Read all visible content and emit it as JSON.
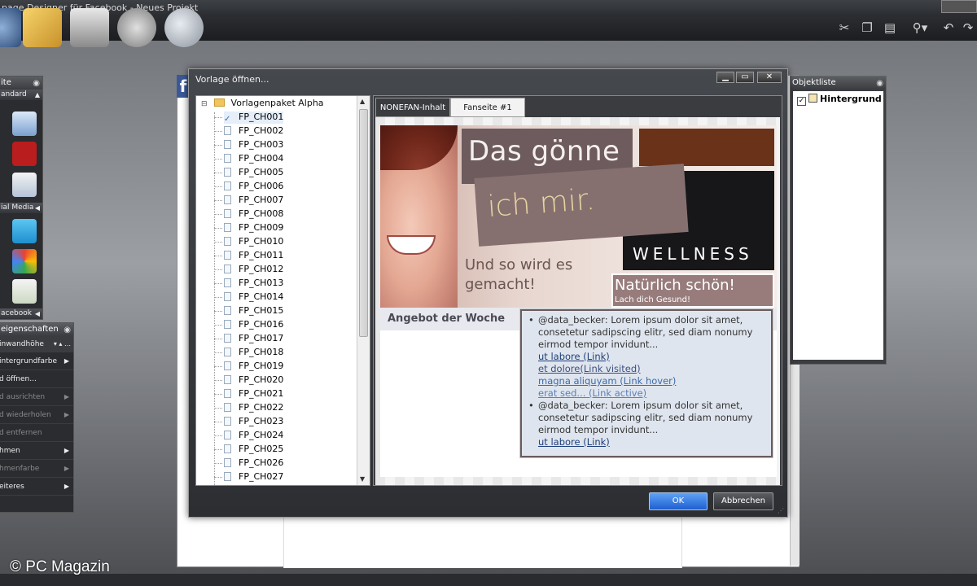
{
  "app": {
    "title": "page Designer für Facebook - Neues Projekt"
  },
  "left_panel": {
    "title": "ite",
    "sections": [
      "andard",
      "ial Media",
      "acebook"
    ]
  },
  "properties_panel": {
    "title": "eigenschaften",
    "field_label": "inwandhöhe",
    "items": [
      {
        "label": "intergrundfarbe",
        "enabled": true,
        "submenu": true
      },
      {
        "label": "d öffnen...",
        "enabled": true,
        "submenu": false
      },
      {
        "label": "d ausrichten",
        "enabled": false,
        "submenu": true
      },
      {
        "label": "d wiederholen",
        "enabled": false,
        "submenu": true
      },
      {
        "label": "d entfernen",
        "enabled": false,
        "submenu": false
      },
      {
        "label": "hmen",
        "enabled": true,
        "submenu": true
      },
      {
        "label": "hmenfarbe",
        "enabled": false,
        "submenu": true
      },
      {
        "label": "eiteres",
        "enabled": true,
        "submenu": true
      }
    ]
  },
  "object_list": {
    "title": "Objektliste",
    "items": [
      {
        "label": "Hintergrund",
        "checked": true
      }
    ]
  },
  "dialog": {
    "title": "Vorlage öffnen...",
    "tree": {
      "root": "Vorlagenpaket Alpha",
      "items": [
        "FP_CH001",
        "FP_CH002",
        "FP_CH003",
        "FP_CH004",
        "FP_CH005",
        "FP_CH006",
        "FP_CH007",
        "FP_CH008",
        "FP_CH009",
        "FP_CH010",
        "FP_CH011",
        "FP_CH012",
        "FP_CH013",
        "FP_CH014",
        "FP_CH015",
        "FP_CH016",
        "FP_CH017",
        "FP_CH018",
        "FP_CH019",
        "FP_CH020",
        "FP_CH021",
        "FP_CH022",
        "FP_CH023",
        "FP_CH024",
        "FP_CH025",
        "FP_CH026",
        "FP_CH027"
      ],
      "selected_index": 0
    },
    "tabs": [
      {
        "label": "NONEFAN-Inhalt",
        "active": false
      },
      {
        "label": "Fanseite #1",
        "active": true
      }
    ],
    "preview": {
      "headline_1": "Das gönne",
      "headline_2": "ich mir.",
      "wellness": "WELLNESS",
      "subline": "Und so wird es gemacht!",
      "natuerlich": "Natürlich schön!",
      "lach": "Lach dich Gesund!",
      "offer_title": "Angebot der Woche",
      "offer_items": [
        {
          "text": "@data_becker: Lorem ipsum dolor sit amet, consetetur sadipscing elitr, sed diam nonumy eirmod tempor invidunt...",
          "links": [
            "ut labore (Link)",
            "et dolore(Link visited)",
            "magna aliquyam (Link hover)",
            "erat sed... (Link active)"
          ]
        },
        {
          "text": "@data_becker: Lorem ipsum dolor sit amet, consetetur sadipscing elitr, sed diam nonumy eirmod tempor invidunt...",
          "links": [
            "ut labore (Link)"
          ]
        }
      ]
    },
    "buttons": {
      "ok": "OK",
      "cancel": "Abbrechen"
    }
  },
  "watermark": "© PC Magazin",
  "colors": {
    "accent_blue": "#1d5fd1",
    "brown_block": "#6a3219",
    "mauve_block": "#86706f"
  }
}
